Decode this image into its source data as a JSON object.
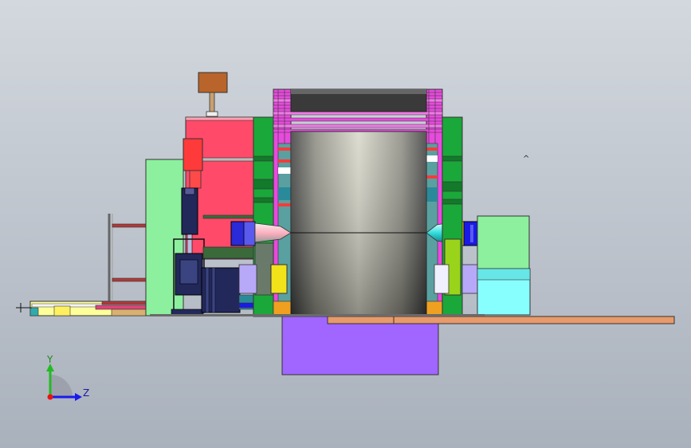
{
  "viewport": {
    "background_top": "#d3d8de",
    "background_bottom": "#a9b1bc"
  },
  "triad": {
    "y_label": "Y",
    "z_label": "Z",
    "y_color": "#22bb22",
    "z_color": "#1a1aee",
    "x_color": "#ee1111"
  },
  "palette": {
    "magenta": "#e64bdc",
    "green": "#1aa83a",
    "light_green": "#8cf09e",
    "red_body": "#ff4a6a",
    "red_block": "#ff3a3a",
    "brown": "#b8642a",
    "purple_base": "#a066ff",
    "orange_plate": "#e89a6a",
    "navy": "#22285a",
    "blue": "#1a1ae8",
    "yellow": "#f2e21a",
    "lime": "#9ad41a",
    "cyan": "#88ffff",
    "light_yellow": "#ffff9a",
    "drum_dark": "#3a3a3a",
    "drum_light": "#d6d6c8"
  }
}
